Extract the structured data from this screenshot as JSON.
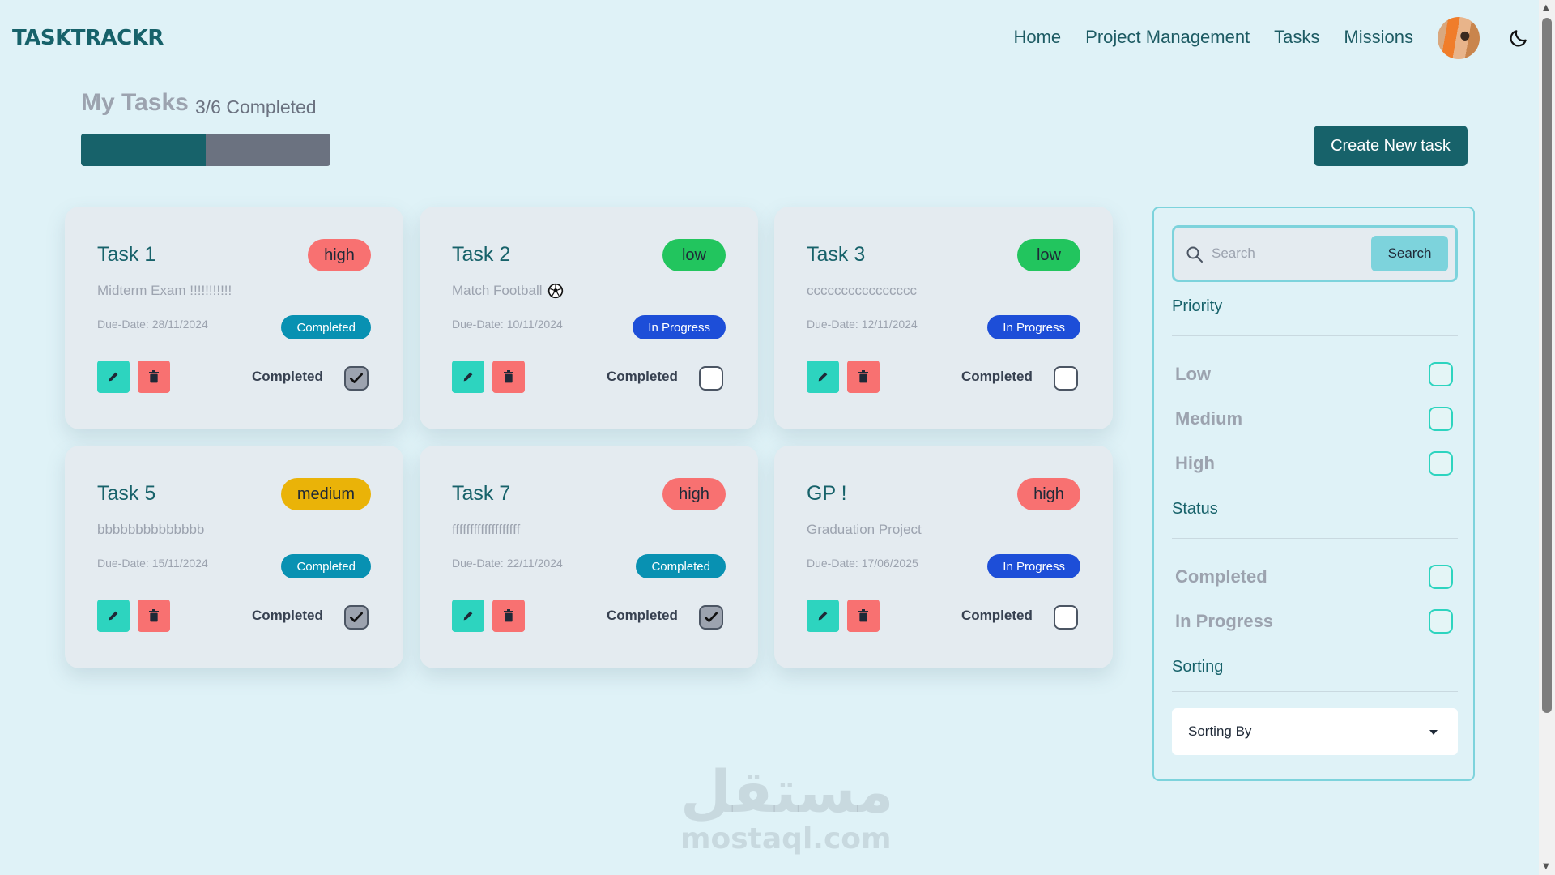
{
  "app": {
    "logo": "TASKTRACKR"
  },
  "nav": {
    "items": [
      "Home",
      "Project Management",
      "Tasks",
      "Missions"
    ]
  },
  "icons": {
    "avatar": "avatar",
    "theme_toggle": "moon-icon",
    "search": "search-icon",
    "edit": "pencil-icon",
    "delete": "trash-icon",
    "check": "check-icon",
    "football": "soccer-ball-icon",
    "sort": "chevron-down-icon"
  },
  "summary": {
    "title": "My Tasks",
    "completed_text": "3/6 Completed",
    "completed": 3,
    "total": 6
  },
  "actions": {
    "create_label": "Create New task"
  },
  "tasks": [
    {
      "title": "Task 1",
      "priority": "high",
      "description": "Midterm Exam !!!!!!!!!!!",
      "due": "Due-Date: 28/11/2024",
      "status": "Completed",
      "completed_label": "Completed",
      "checked": true,
      "icon": ""
    },
    {
      "title": "Task 2",
      "priority": "low",
      "description": "Match Football",
      "due": "Due-Date: 10/11/2024",
      "status": "In Progress",
      "completed_label": "Completed",
      "checked": false,
      "icon": "soccer-ball-icon"
    },
    {
      "title": "Task 3",
      "priority": "low",
      "description": "cccccccccccccccc",
      "due": "Due-Date: 12/11/2024",
      "status": "In Progress",
      "completed_label": "Completed",
      "checked": false,
      "icon": ""
    },
    {
      "title": "Task 5",
      "priority": "medium",
      "description": "bbbbbbbbbbbbbb",
      "due": "Due-Date: 15/11/2024",
      "status": "Completed",
      "completed_label": "Completed",
      "checked": true,
      "icon": ""
    },
    {
      "title": "Task 7",
      "priority": "high",
      "description": "fffffffffffffffffff",
      "due": "Due-Date: 22/11/2024",
      "status": "Completed",
      "completed_label": "Completed",
      "checked": true,
      "icon": ""
    },
    {
      "title": "GP !",
      "priority": "high",
      "description": "Graduation Project",
      "due": "Due-Date: 17/06/2025",
      "status": "In Progress",
      "completed_label": "Completed",
      "checked": false,
      "icon": ""
    }
  ],
  "filters": {
    "search_placeholder": "Search",
    "search_button": "Search",
    "priority_title": "Priority",
    "priority_options": [
      "Low",
      "Medium",
      "High"
    ],
    "status_title": "Status",
    "status_options": [
      "Completed",
      "In Progress"
    ],
    "sorting_title": "Sorting",
    "sorting_value": "Sorting By"
  },
  "colors": {
    "background": "#dff2f7",
    "brand": "#17626a",
    "high": "#f87171",
    "low": "#22c55e",
    "medium": "#eab308",
    "status_completed": "#0891b2",
    "status_in_progress": "#1d4ed8",
    "edit": "#2dd4bf",
    "delete": "#f87171"
  },
  "watermark": {
    "arabic": "مستقل",
    "latin": "mostaql.com"
  }
}
